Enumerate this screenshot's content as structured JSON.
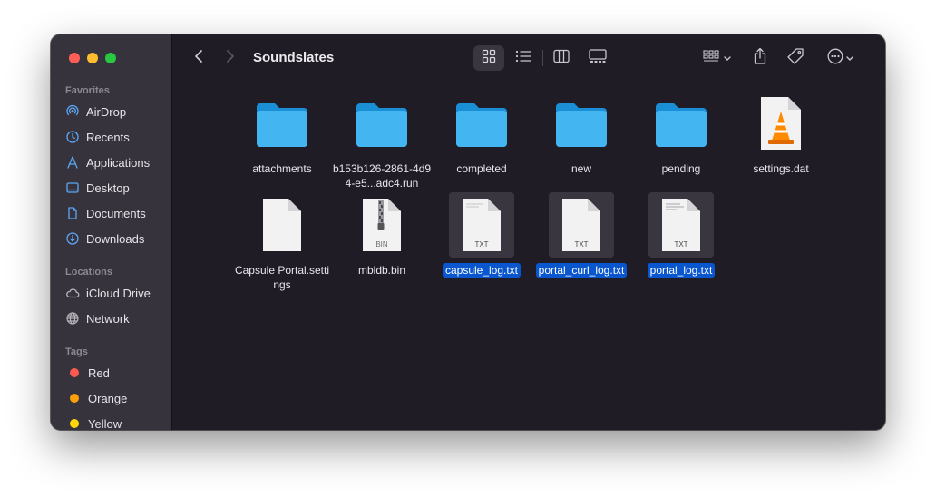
{
  "window": {
    "title": "Soundslates"
  },
  "sidebar": {
    "favorites_header": "Favorites",
    "favorites": [
      {
        "label": "AirDrop",
        "icon": "airdrop-icon"
      },
      {
        "label": "Recents",
        "icon": "clock-icon"
      },
      {
        "label": "Applications",
        "icon": "applications-icon"
      },
      {
        "label": "Desktop",
        "icon": "desktop-icon"
      },
      {
        "label": "Documents",
        "icon": "document-icon"
      },
      {
        "label": "Downloads",
        "icon": "download-icon"
      }
    ],
    "locations_header": "Locations",
    "locations": [
      {
        "label": "iCloud Drive",
        "icon": "cloud-icon"
      },
      {
        "label": "Network",
        "icon": "globe-icon"
      }
    ],
    "tags_header": "Tags",
    "tags": [
      {
        "label": "Red",
        "color": "#ff5a52"
      },
      {
        "label": "Orange",
        "color": "#ff9f0a"
      },
      {
        "label": "Yellow",
        "color": "#ffd60a"
      }
    ]
  },
  "files": [
    {
      "name": "attachments",
      "type": "folder",
      "selected": false
    },
    {
      "name": "b153b126-2861-4d94-e5...adc4.run",
      "type": "folder",
      "selected": false
    },
    {
      "name": "completed",
      "type": "folder",
      "selected": false
    },
    {
      "name": "new",
      "type": "folder",
      "selected": false
    },
    {
      "name": "pending",
      "type": "folder",
      "selected": false
    },
    {
      "name": "settings.dat",
      "type": "vlc-document",
      "selected": false
    },
    {
      "name": "Capsule Portal.settings",
      "type": "document",
      "selected": false
    },
    {
      "name": "mbldb.bin",
      "type": "binary",
      "badge": "BIN",
      "selected": false
    },
    {
      "name": "capsule_log.txt",
      "type": "text",
      "badge": "TXT",
      "selected": true
    },
    {
      "name": "portal_curl_log.txt",
      "type": "text",
      "badge": "TXT",
      "selected": true
    },
    {
      "name": "portal_log.txt",
      "type": "text",
      "badge": "TXT",
      "selected": true
    }
  ],
  "colors": {
    "accent": "#0a56cf",
    "folder": "#3fb2f0",
    "window_bg": "#201c26",
    "sidebar_bg": "#37333c"
  }
}
